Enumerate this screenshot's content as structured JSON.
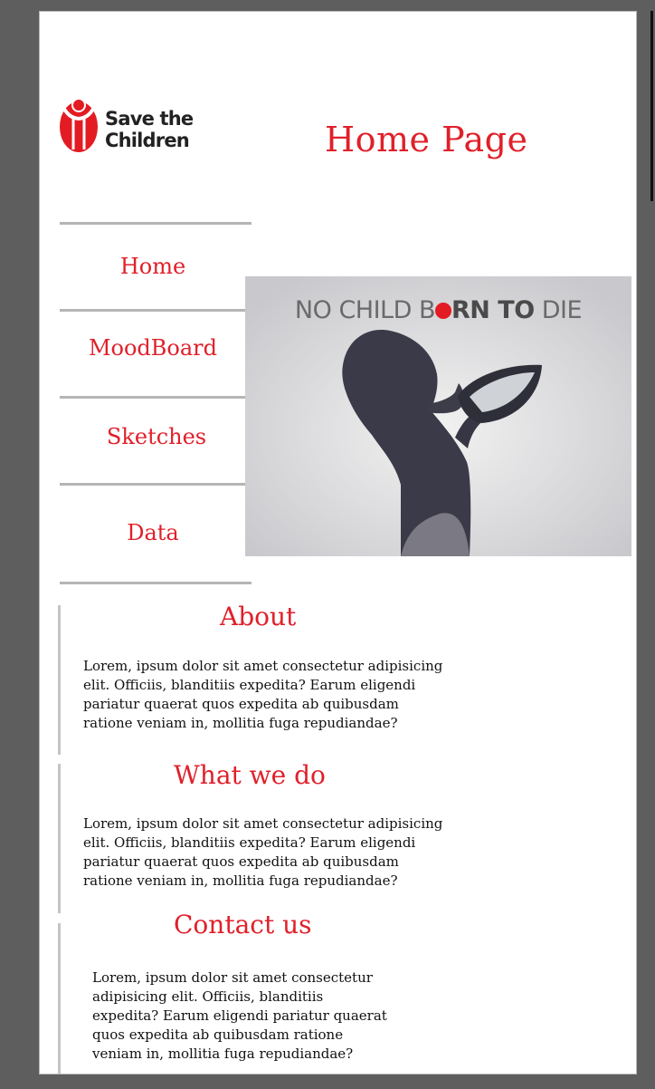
{
  "header": {
    "logo_text": "Save the Children",
    "page_title": "Home Page"
  },
  "nav": {
    "items": [
      {
        "label": "Home"
      },
      {
        "label": "MoodBoard"
      },
      {
        "label": "Sketches"
      },
      {
        "label": "Data"
      }
    ]
  },
  "hero": {
    "text_part1": "NO CHILD B",
    "text_part2": "RN TO",
    "text_part3": " DIE"
  },
  "sections": [
    {
      "title": "About",
      "body": "Lorem, ipsum dolor sit amet consectetur adipisicing elit. Officiis, blanditiis expedita? Earum eligendi pariatur quaerat quos expedita ab quibusdam ratione veniam in, mollitia fuga repudiandae?"
    },
    {
      "title": "What we do",
      "body": "Lorem, ipsum dolor sit amet consectetur adipisicing elit. Officiis, blanditiis expedita? Earum eligendi pariatur quaerat quos expedita ab quibusdam ratione veniam in, mollitia fuga repudiandae?"
    },
    {
      "title": "Contact us",
      "body": "Lorem, ipsum dolor sit amet consectetur adipisicing elit. Officiis, blanditiis expedita? Earum eligendi pariatur quaerat quos expedita ab quibusdam ratione veniam in, mollitia fuga repudiandae?"
    }
  ],
  "colors": {
    "brand_red": "#e0202a",
    "separator_gray": "#b5b5b5"
  },
  "icons": {
    "logo": "child-figure-icon"
  }
}
